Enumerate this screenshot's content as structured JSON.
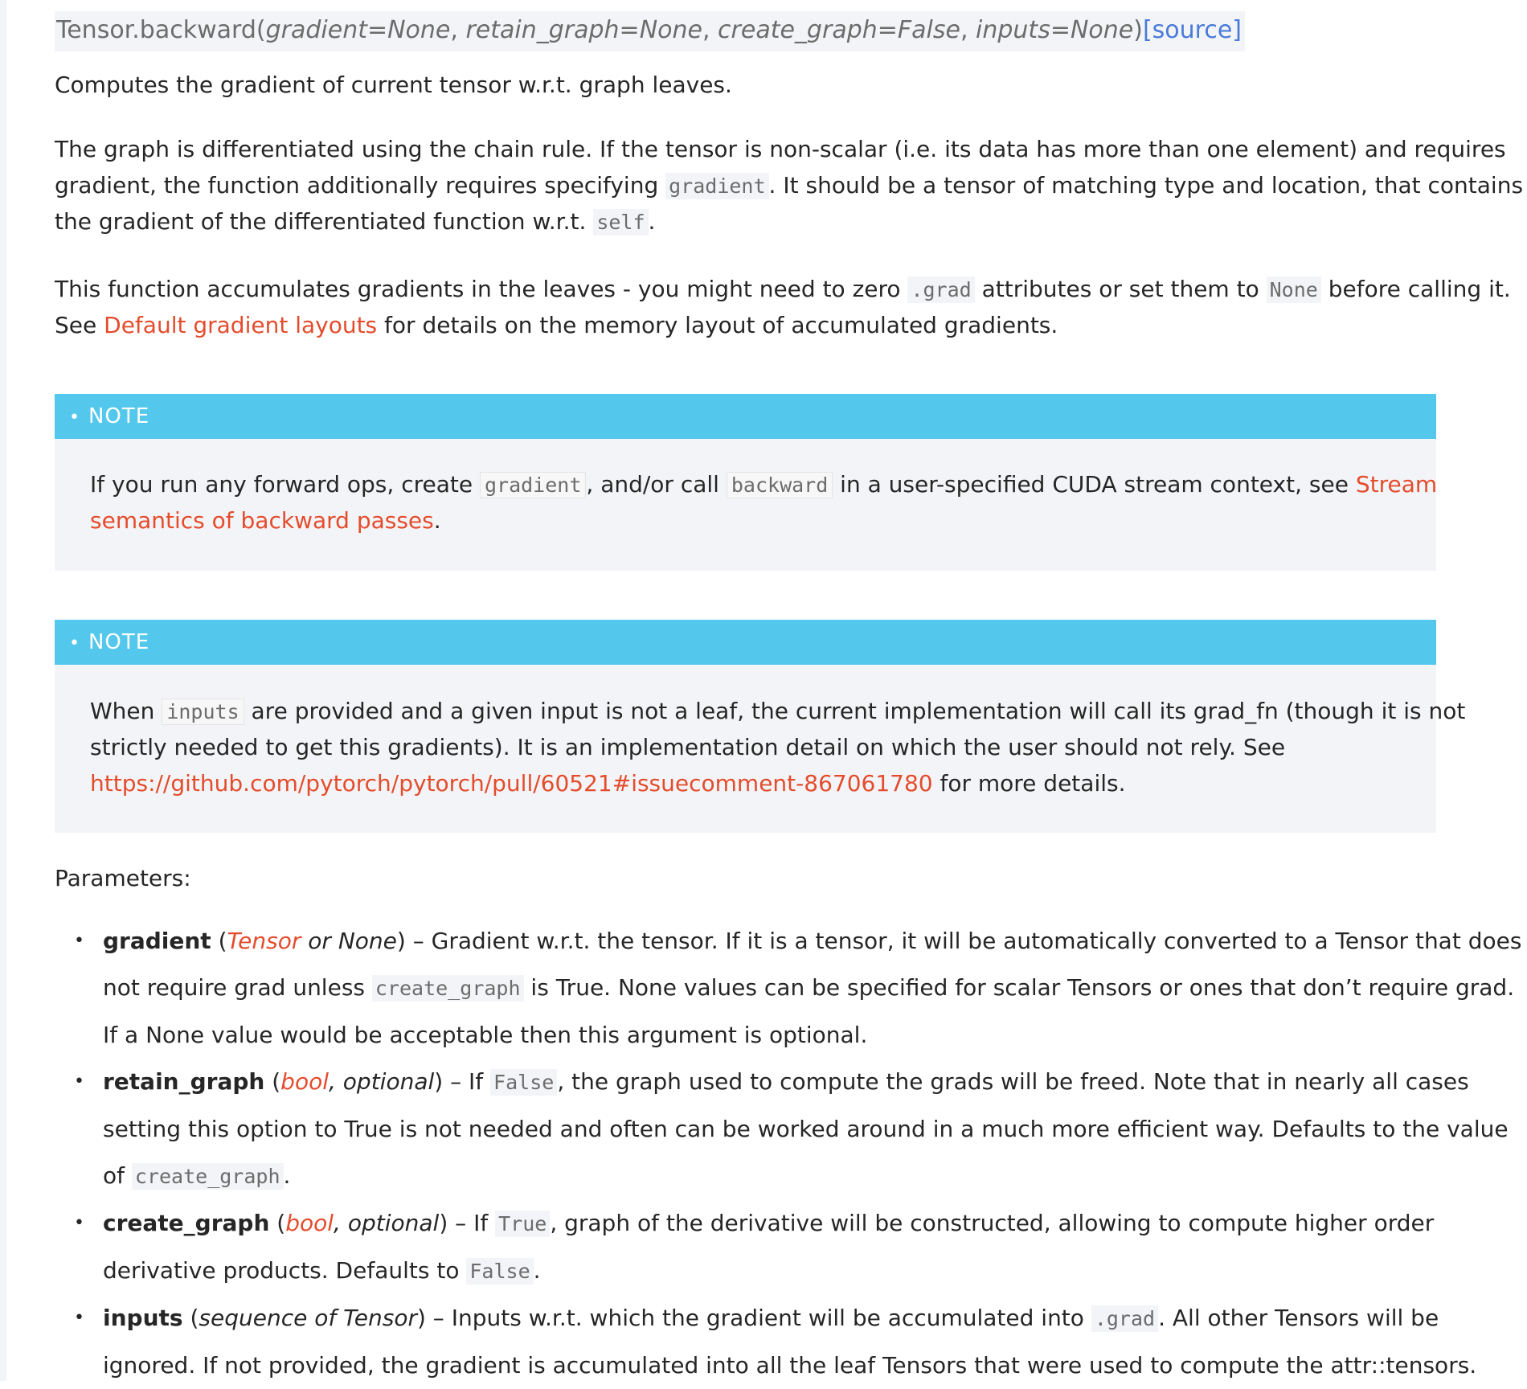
{
  "signature": {
    "name": "Tensor.backward",
    "open": "(",
    "params": [
      "gradient=None",
      "retain_graph=None",
      "create_graph=False",
      "inputs=None"
    ],
    "sep": ", ",
    "close": ")",
    "source_label": "[source]"
  },
  "summary": "Computes the gradient of current tensor w.r.t. graph leaves.",
  "para1": {
    "l1": "The graph is differentiated using the chain rule. If the tensor is non-scalar (i.e. its data has more than one element) and requires",
    "l2a": "gradient, the function additionally requires specifying ",
    "l2code": "gradient",
    "l2b": ". It should be a tensor of matching type and location, that contains",
    "l3a": "the gradient of the differentiated function w.r.t. ",
    "l3code": "self",
    "l3b": "."
  },
  "para2": {
    "l1a": "This function accumulates gradients in the leaves - you might need to zero ",
    "l1code1": ".grad",
    "l1b": " attributes or set them to ",
    "l1code2": "None",
    "l1c": " before calling it.",
    "l2a": "See ",
    "l2link": "Default gradient layouts",
    "l2b": " for details on the memory layout of accumulated gradients."
  },
  "notes": [
    {
      "title": "NOTE",
      "l1a": "If you run any forward ops, create ",
      "l1code1": "gradient",
      "l1b": ", and/or call ",
      "l1code2": "backward",
      "l1c": " in a user-specified CUDA stream context, see ",
      "l1link": "Stream",
      "l2link": "semantics of backward passes",
      "l2b": "."
    },
    {
      "title": "NOTE",
      "l1a": "When ",
      "l1code": "inputs",
      "l1b": " are provided and a given input is not a leaf, the current implementation will call its grad_fn (though it is not",
      "l2": "strictly needed to get this gradients). It is an implementation detail on which the user should not rely. See",
      "l3link": "https://github.com/pytorch/pytorch/pull/60521#issuecomment-867061780",
      "l3b": " for more details."
    }
  ],
  "parameters_label": "Parameters:",
  "bullet": "•",
  "params": [
    {
      "name": "gradient",
      "open": " (",
      "type_link": "Tensor",
      "type_rest": " or None",
      "close": ")",
      "l1": " – Gradient w.r.t. the tensor. If it is a tensor, it will be automatically converted to a Tensor that does",
      "l2a": "not require grad unless ",
      "l2code": "create_graph",
      "l2b": " is True. None values can be specified for scalar Tensors or ones that don’t require grad.",
      "l3": "If a None value would be acceptable then this argument is optional."
    },
    {
      "name": "retain_graph",
      "open": " (",
      "type_link": "bool",
      "type_rest": ", optional",
      "close": ")",
      "l1a": " – If ",
      "l1code": "False",
      "l1b": ", the graph used to compute the grads will be freed. Note that in nearly all cases",
      "l2": "setting this option to True is not needed and often can be worked around in a much more efficient way. Defaults to the value",
      "l3a": "of ",
      "l3code": "create_graph",
      "l3b": "."
    },
    {
      "name": "create_graph",
      "open": " (",
      "type_link": "bool",
      "type_rest": ", optional",
      "close": ")",
      "l1a": " – If ",
      "l1code": "True",
      "l1b": ", graph of the derivative will be constructed, allowing to compute higher order",
      "l2a": "derivative products. Defaults to ",
      "l2code": "False",
      "l2b": "."
    },
    {
      "name": "inputs",
      "open": " (",
      "type_rest": "sequence of Tensor",
      "close": ")",
      "l1a": " – Inputs w.r.t. which the gradient will be accumulated into ",
      "l1code": ".grad",
      "l1b": ". All other Tensors will be",
      "l2": "ignored. If not provided, the gradient is accumulated into all the leaf Tensors that were used to compute the attr::tensors."
    }
  ]
}
